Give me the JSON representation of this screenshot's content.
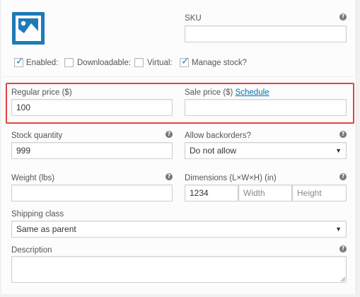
{
  "sku": {
    "label": "SKU",
    "value": ""
  },
  "options": {
    "enabled": {
      "label": "Enabled:",
      "checked": true
    },
    "downloadable": {
      "label": "Downloadable:",
      "checked": false
    },
    "virtual": {
      "label": "Virtual:",
      "checked": false
    },
    "manage_stock": {
      "label": "Manage stock?",
      "checked": true
    }
  },
  "regular_price": {
    "label": "Regular price ($)",
    "value": "100"
  },
  "sale_price": {
    "label": "Sale price ($)",
    "link": "Schedule",
    "value": ""
  },
  "stock_quantity": {
    "label": "Stock quantity",
    "value": "999"
  },
  "backorders": {
    "label": "Allow backorders?",
    "selected": "Do not allow"
  },
  "weight": {
    "label": "Weight (lbs)",
    "value": ""
  },
  "dimensions": {
    "label": "Dimensions (L×W×H) (in)",
    "length": "1234",
    "width_placeholder": "Width",
    "height_placeholder": "Height"
  },
  "shipping_class": {
    "label": "Shipping class",
    "selected": "Same as parent"
  },
  "description": {
    "label": "Description",
    "value": ""
  },
  "colors": {
    "accent": "#0073aa",
    "highlight": "#e04343",
    "thumb": "#1f7ab8"
  }
}
